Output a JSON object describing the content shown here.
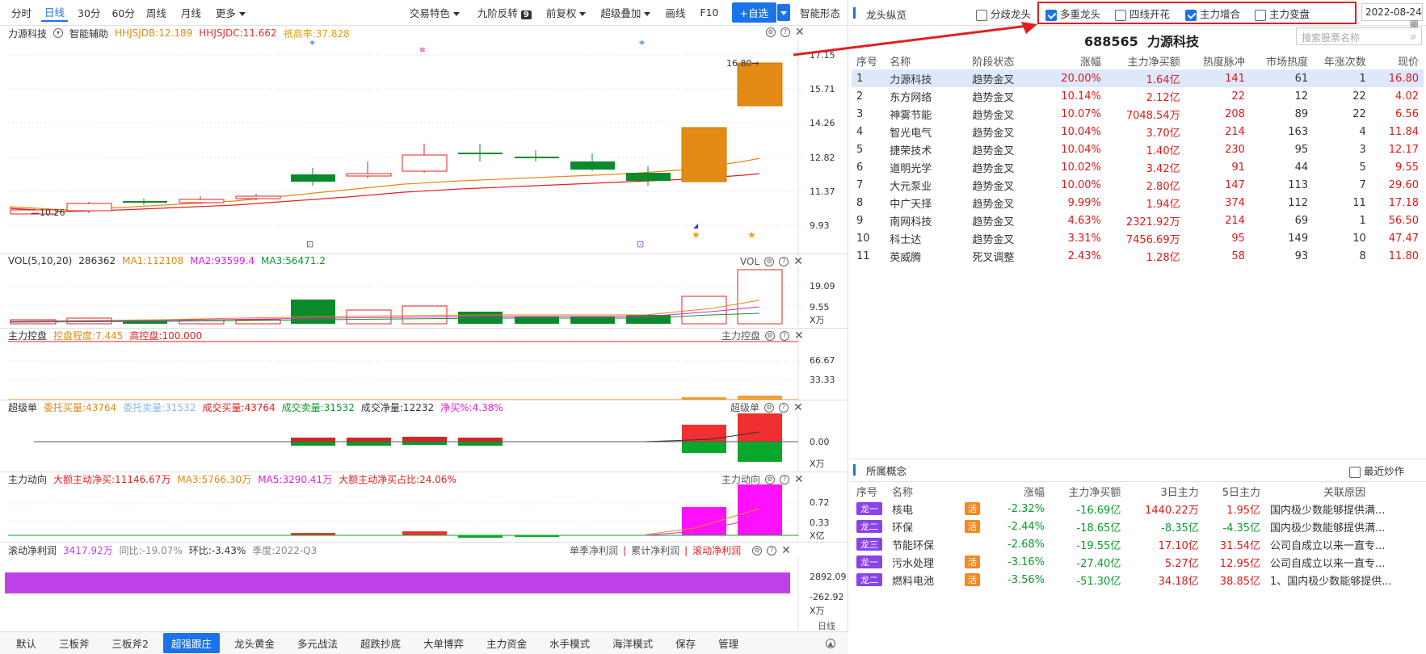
{
  "toolbar": {
    "periods": [
      "分时",
      "日线",
      "30分",
      "60分",
      "周线",
      "月线",
      "更多"
    ],
    "active_period": "日线",
    "right_items": [
      "交易特色",
      "九阶反转",
      "前复权",
      "超级叠加",
      "画线",
      "F10"
    ],
    "nine_badge": "9",
    "add_button": "+自选",
    "smart_shape": "智能形态"
  },
  "chart": {
    "stock_name": "力源科技",
    "assist": "智能辅助",
    "ind1": "HHJSJDB:12.189",
    "ind2": "HHJSJDC:11.662",
    "ind3": "祇高率:37.828",
    "price_axis": [
      "17.15",
      "15.71",
      "14.26",
      "12.82",
      "11.37",
      "9.93"
    ],
    "high_label": "16.80",
    "low_label": "10.26"
  },
  "vol": {
    "title": "VOL(5,10,20)",
    "value": "286362",
    "ma1": "MA1:112108",
    "ma2": "MA2:93599.4",
    "ma3": "MA3:56471.2",
    "tag": "VOL",
    "axis": [
      "19.09",
      "9.55",
      "X万"
    ]
  },
  "kongpan": {
    "title": "主力控盘",
    "deg": "控盘程度:7.445",
    "high": "高控盘:100.000",
    "tag": "主力控盘",
    "axis": [
      "66.67",
      "33.33"
    ]
  },
  "super": {
    "title": "超级单",
    "buy": "委托买量:43764",
    "sell": "委托卖量:31532",
    "deal_buy": "成交买量:43764",
    "deal_sell": "成交卖量:31532",
    "net": "成交净量:12232",
    "pct": "净买%:4.38%",
    "tag": "超级单",
    "axis": [
      "0.00",
      "X万"
    ]
  },
  "flow": {
    "title": "主力动向",
    "big": "大额主动净买:11146.67万",
    "ma3": "MA3:5766.30万",
    "ma5": "MA5:3290.41万",
    "ratio": "大额主动净买占比:24.06%",
    "tag": "主力动向",
    "axis": [
      "0.72",
      "0.33",
      "X亿"
    ]
  },
  "profit": {
    "title": "滚动净利润",
    "value": "3417.92万",
    "yoy": "同比:-19.07%",
    "qoq": "环比:-3.43%",
    "season": "季度:2022-Q3",
    "tabs": [
      "单季净利润",
      "累计净利润",
      "滚动净利润"
    ],
    "axis": [
      "2892.09",
      "-262.92",
      "X万",
      "日线"
    ]
  },
  "bottom_tabs": [
    "默认",
    "三板斧",
    "三板斧2",
    "超强跟庄",
    "龙头黄金",
    "多元战法",
    "超跌抄底",
    "大单博弈",
    "主力资金",
    "水手模式",
    "海洋模式",
    "保存",
    "管理"
  ],
  "bottom_active": "超强跟庄",
  "right": {
    "title": "龙头纵览",
    "options": [
      {
        "label": "分歧龙头",
        "checked": false
      },
      {
        "label": "多重龙头",
        "checked": true
      },
      {
        "label": "四线开花",
        "checked": false
      },
      {
        "label": "主力增合",
        "checked": true
      },
      {
        "label": "主力变盘",
        "checked": false
      }
    ],
    "date": "2022-08-24",
    "stock_code": "688565",
    "stock_name": "力源科技",
    "search_placeholder": "搜索股票名称",
    "headers": [
      "序号",
      "名称",
      "阶段状态",
      "涨幅",
      "主力净买额",
      "热度脉冲",
      "市场热度",
      "年涨次数",
      "现价"
    ],
    "rows": [
      [
        "1",
        "力源科技",
        "趋势金叉",
        "20.00%",
        "1.64亿",
        "141",
        "61",
        "1",
        "16.80"
      ],
      [
        "2",
        "东方网络",
        "趋势金叉",
        "10.14%",
        "2.12亿",
        "22",
        "12",
        "22",
        "4.02"
      ],
      [
        "3",
        "神雾节能",
        "趋势金叉",
        "10.07%",
        "7048.54万",
        "208",
        "89",
        "22",
        "6.56"
      ],
      [
        "4",
        "智光电气",
        "趋势金叉",
        "10.04%",
        "3.70亿",
        "214",
        "163",
        "4",
        "11.84"
      ],
      [
        "5",
        "捷荣技术",
        "趋势金叉",
        "10.04%",
        "1.40亿",
        "230",
        "95",
        "3",
        "12.17"
      ],
      [
        "6",
        "道明光学",
        "趋势金叉",
        "10.02%",
        "3.42亿",
        "91",
        "44",
        "5",
        "9.55"
      ],
      [
        "7",
        "大元泵业",
        "趋势金叉",
        "10.00%",
        "2.80亿",
        "147",
        "113",
        "7",
        "29.60"
      ],
      [
        "8",
        "中广天择",
        "趋势金叉",
        "9.99%",
        "1.94亿",
        "374",
        "112",
        "11",
        "17.18"
      ],
      [
        "9",
        "南网科技",
        "趋势金叉",
        "4.63%",
        "2321.92万",
        "214",
        "69",
        "1",
        "56.50"
      ],
      [
        "10",
        "科士达",
        "趋势金叉",
        "3.31%",
        "7456.69万",
        "95",
        "149",
        "10",
        "47.47"
      ],
      [
        "11",
        "英威腾",
        "死叉调整",
        "2.43%",
        "1.28亿",
        "58",
        "93",
        "8",
        "11.80"
      ]
    ],
    "concept_title": "所属概念",
    "recent_label": "最近炒作",
    "concept_headers": [
      "序号",
      "名称",
      "涨幅",
      "主力净买额",
      "3日主力",
      "5日主力",
      "关联原因"
    ],
    "concepts": [
      {
        "tag": "龙一",
        "name": "核电",
        "huo": true,
        "chg": "-2.32%",
        "net": "-16.69亿",
        "d3": "1440.22万",
        "d5": "1.95亿",
        "reason": "国内极少数能够提供满..."
      },
      {
        "tag": "龙二",
        "name": "环保",
        "huo": true,
        "chg": "-2.44%",
        "net": "-18.65亿",
        "d3": "-8.35亿",
        "d5": "-4.35亿",
        "reason": "国内极少数能够提供满..."
      },
      {
        "tag": "龙三",
        "name": "节能环保",
        "huo": false,
        "chg": "-2.68%",
        "net": "-19.55亿",
        "d3": "17.10亿",
        "d5": "31.54亿",
        "reason": "公司自成立以来一直专..."
      },
      {
        "tag": "龙一",
        "name": "污水处理",
        "huo": true,
        "chg": "-3.16%",
        "net": "-27.40亿",
        "d3": "5.27亿",
        "d5": "12.95亿",
        "reason": "公司自成立以来一直专..."
      },
      {
        "tag": "龙二",
        "name": "燃料电池",
        "huo": true,
        "chg": "-3.56%",
        "net": "-51.30亿",
        "d3": "34.18亿",
        "d5": "38.85亿",
        "reason": "1、国内极少数能够提供..."
      }
    ],
    "huo_label": "活"
  }
}
